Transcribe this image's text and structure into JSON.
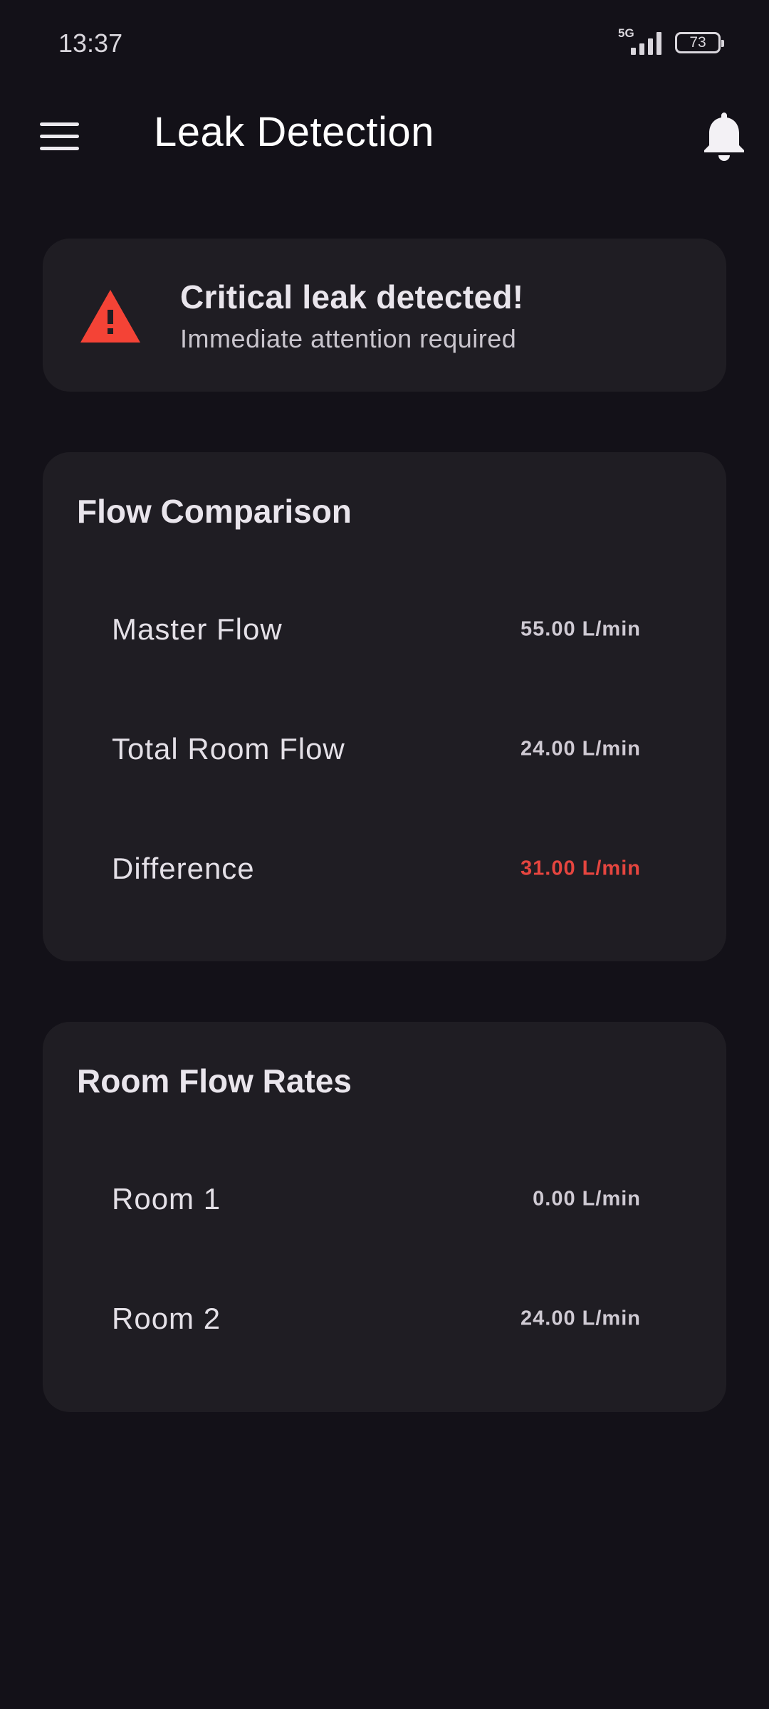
{
  "status_bar": {
    "time": "13:37",
    "network": "5G",
    "battery": "73"
  },
  "app_bar": {
    "title": "Leak Detection",
    "menu_icon": "menu-icon",
    "bell_icon": "bell-icon"
  },
  "alert": {
    "icon": "warning-triangle-icon",
    "icon_color": "#f44336",
    "title": "Critical leak detected!",
    "subtitle": "Immediate attention required"
  },
  "flow_comparison": {
    "title": "Flow Comparison",
    "rows": [
      {
        "label": "Master Flow",
        "value": "55.00 L/min"
      },
      {
        "label": "Total Room Flow",
        "value": "24.00 L/min"
      },
      {
        "label": "Difference",
        "value": "31.00 L/min",
        "color": "#e5453f"
      }
    ]
  },
  "room_flow_rates": {
    "title": "Room Flow Rates",
    "rows": [
      {
        "label": "Room 1",
        "value": "0.00 L/min"
      },
      {
        "label": "Room 2",
        "value": "24.00 L/min"
      }
    ]
  },
  "theme": {
    "background": "#131118",
    "card": "#1f1d23",
    "text": "#e7e3ea"
  }
}
